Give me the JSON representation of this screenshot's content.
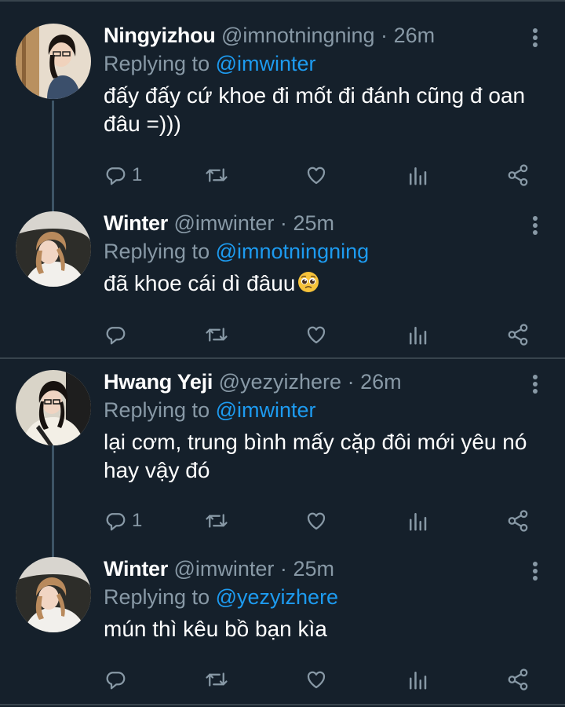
{
  "colors": {
    "background": "#15202b",
    "mention": "#1d9bf0",
    "muted": "#8899a6",
    "divider": "#38444d"
  },
  "reply_prefix": "Replying to",
  "tweets": [
    {
      "name": "Ningyizhou",
      "handle": "@imnotningning",
      "sep": "·",
      "time": "26m",
      "reply_to": "@imwinter",
      "text": "đấy đấy cứ khoe đi mốt đi đánh cũng đ oan đâu =)))",
      "reply_count": "1",
      "icons": [
        "reply-icon",
        "retweet-icon",
        "like-icon",
        "analytics-icon",
        "share-icon"
      ]
    },
    {
      "name": "Winter",
      "handle": "@imwinter",
      "sep": "·",
      "time": "25m",
      "reply_to": "@imnotningning",
      "text": "đã khoe cái dì đâuu",
      "emoji": "pleading-face-emoji",
      "reply_count": "",
      "icons": [
        "reply-icon",
        "retweet-icon",
        "like-icon",
        "analytics-icon",
        "share-icon"
      ]
    },
    {
      "name": "Hwang Yeji",
      "handle": "@yezyizhere",
      "sep": "·",
      "time": "26m",
      "reply_to": "@imwinter",
      "text": "lại cơm, trung bình mấy cặp đôi mới yêu nó hay vậy đó",
      "reply_count": "1",
      "icons": [
        "reply-icon",
        "retweet-icon",
        "like-icon",
        "analytics-icon",
        "share-icon"
      ]
    },
    {
      "name": "Winter",
      "handle": "@imwinter",
      "sep": "·",
      "time": "25m",
      "reply_to": "@yezyizhere",
      "text": "mún thì kêu bồ bạn kìa",
      "reply_count": "",
      "icons": [
        "reply-icon",
        "retweet-icon",
        "like-icon",
        "analytics-icon",
        "share-icon"
      ]
    }
  ]
}
